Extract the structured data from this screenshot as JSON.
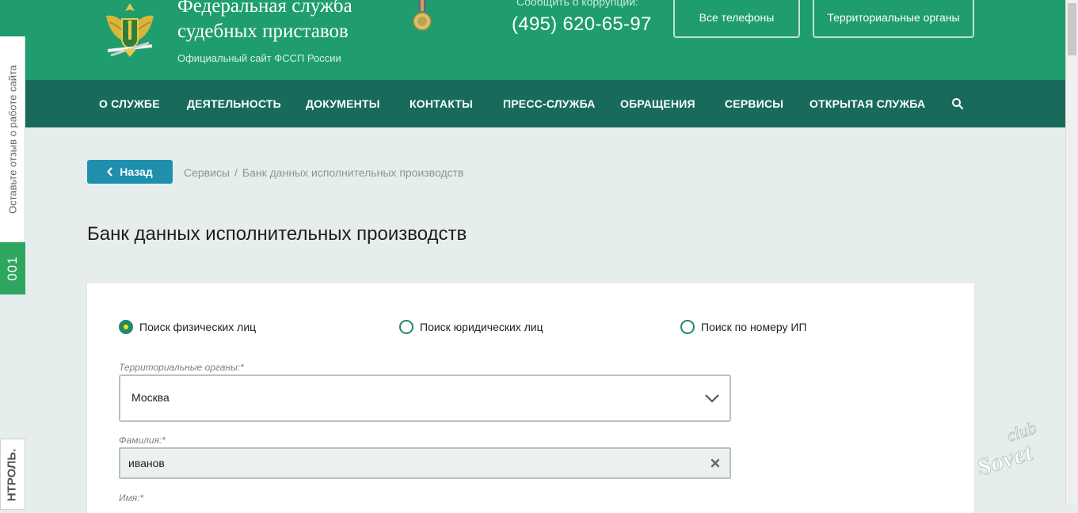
{
  "header": {
    "title_line1": "Федеральная служба",
    "title_line2": "судебных приставов",
    "subtitle": "Официальный сайт ФССП России",
    "corruption_label": "Сообщить о коррупции:",
    "corruption_phone": "(495) 620-65-97",
    "btn_phones": "Все телефоны",
    "btn_orgs": "Территориальные органы"
  },
  "nav": {
    "items": [
      "О СЛУЖБЕ",
      "ДЕЯТЕЛЬНОСТЬ",
      "ДОКУМЕНТЫ",
      "КОНТАКТЫ",
      "ПРЕСС-СЛУЖБА",
      "ОБРАЩЕНИЯ",
      "СЕРВИСЫ",
      "ОТКРЫТАЯ СЛУЖБА"
    ]
  },
  "side": {
    "feedback": "Оставьте отзыв о работе сайта",
    "number": "001",
    "control": "НТРОЛЬ."
  },
  "breadcrumb": {
    "back": "Назад",
    "items": [
      "Сервисы",
      "Банк данных исполнительных производств"
    ]
  },
  "page_title": "Банк данных исполнительных производств",
  "form": {
    "radios": [
      "Поиск физических лиц",
      "Поиск юридических лиц",
      "Поиск по номеру ИП"
    ],
    "selected_radio": "Поиск физических лиц",
    "territorial_label": "Территориальные органы:*",
    "territorial_value": "Москва",
    "lastname_label": "Фамилия:*",
    "lastname_value": "иванов",
    "firstname_label": "Имя:*"
  },
  "watermark": {
    "line1": "club",
    "line2": "Sovet"
  },
  "colors": {
    "header_green": "#1f9d6e",
    "nav_green": "#186b5a",
    "back_blue": "#1f8fae",
    "radio_green": "#1f8a6b"
  }
}
